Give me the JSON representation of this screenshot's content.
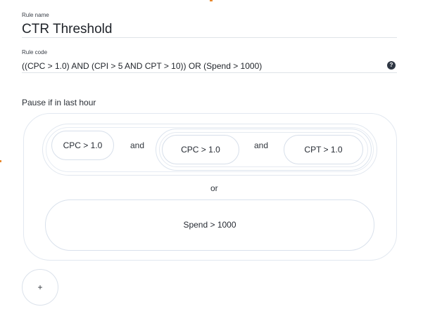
{
  "rule_name": {
    "label": "Rule name",
    "value": "CTR Threshold"
  },
  "rule_code": {
    "label": "Rule code",
    "value": "((CPC > 1.0) AND (CPI > 5 AND CPT > 10)) OR (Spend > 1000)",
    "help_icon": "question-circle-icon",
    "help_text": "?"
  },
  "trigger": {
    "label": "Pause if in last hour"
  },
  "groups": {
    "first_condition": "CPC > 1.0",
    "first_joiner": "and",
    "nested_first_condition": "CPC > 1.0",
    "nested_joiner": "and",
    "nested_second_condition": "CPT > 1.0",
    "or_joiner": "or",
    "spend_condition": "Spend > 1000"
  },
  "actions": {
    "add_label": "+"
  },
  "colors": {
    "accent": "#e8892f",
    "border": "#dbe3ee",
    "text": "#222831",
    "help_icon": "#2f3744"
  }
}
